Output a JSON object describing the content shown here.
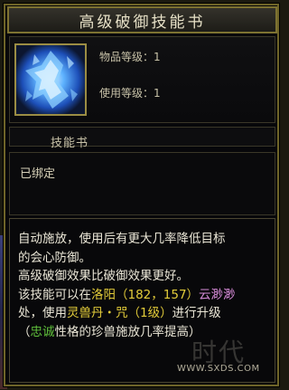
{
  "title": "高级破御技能书",
  "icon": "blue-crystal-skill-book-icon",
  "stats": {
    "item_level": "物品等级：1",
    "use_level": "使用等级：1"
  },
  "category": "技能书",
  "bound_status": "已绑定",
  "description": {
    "line1": "自动施放，使用后有更大几率降低目标",
    "line2": "的会心防御。",
    "line3": "高级破御效果比破御效果更好。",
    "line4_a": "该技能可以在",
    "line4_location": "洛阳（182，157）",
    "line4_npc": "云渺渺",
    "line5_a": "处，使用",
    "line5_item": "灵兽丹・咒（1级）",
    "line5_b": "进行升级",
    "line6_a": "（",
    "line6_trait": "忠诚",
    "line6_b": "性格的珍兽施放几率提高）"
  },
  "watermark": "WWW.SXDS.COM",
  "watermark_big": "时代"
}
